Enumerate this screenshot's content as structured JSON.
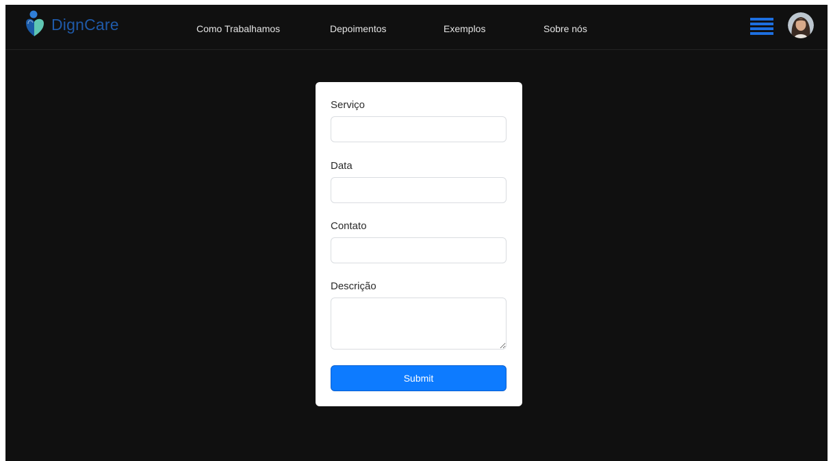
{
  "brand": {
    "name": "DignCare",
    "logo_icon": "heart-person-logo-icon",
    "colors": {
      "person": "#2f7fd8",
      "heart_left": "#1a5aa8",
      "heart_right": "#5fc6b3"
    }
  },
  "nav": {
    "links": [
      {
        "label": "Como Trabalhamos"
      },
      {
        "label": "Depoimentos"
      },
      {
        "label": "Exemplos"
      },
      {
        "label": "Sobre nós"
      }
    ],
    "menu_icon": "hamburger-menu-icon",
    "menu_color": "#1d6fe0",
    "avatar_icon": "user-avatar-icon"
  },
  "form": {
    "fields": [
      {
        "label": "Serviço",
        "value": "",
        "placeholder": ""
      },
      {
        "label": "Data",
        "value": "",
        "placeholder": ""
      },
      {
        "label": "Contato",
        "value": "",
        "placeholder": ""
      },
      {
        "label": "Descrição",
        "value": "",
        "placeholder": ""
      }
    ],
    "submit_label": "Submit",
    "submit_color": "#0d7bff"
  },
  "colors": {
    "background": "#101010",
    "card": "#ffffff"
  }
}
